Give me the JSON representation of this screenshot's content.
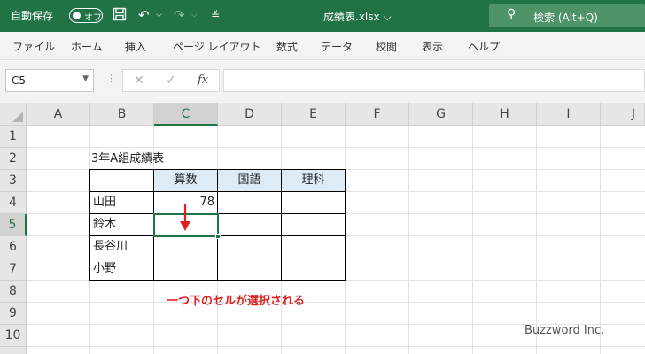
{
  "titlebar": {
    "autosave_label": "自動保存",
    "toggle_label": "オフ",
    "filename": "成績表.xlsx",
    "filename_chevron": "⌵",
    "search_placeholder": "検索 (Alt+Q)",
    "icons": [
      "save-icon",
      "undo-icon",
      "redo-icon",
      "customize-icon"
    ]
  },
  "ribbon": {
    "tabs": [
      "ファイル",
      "ホーム",
      "挿入",
      "ページ レイアウト",
      "数式",
      "データ",
      "校閲",
      "表示",
      "ヘルプ"
    ]
  },
  "formula_bar": {
    "name_box": "C5",
    "formula": "",
    "fx_label": "fx"
  },
  "grid": {
    "columns": [
      "A",
      "B",
      "C",
      "D",
      "E",
      "F",
      "G",
      "H",
      "I",
      "J"
    ],
    "rows": [
      "1",
      "2",
      "3",
      "4",
      "5",
      "6",
      "7",
      "8",
      "9",
      "10"
    ],
    "selected_column": "C",
    "selected_row": "5"
  },
  "sheet": {
    "title": "3年A組成績表",
    "headers": [
      "算数",
      "国語",
      "理科"
    ],
    "students": [
      {
        "name": "山田",
        "scores": [
          "78",
          "",
          ""
        ]
      },
      {
        "name": "鈴木",
        "scores": [
          "",
          "",
          ""
        ]
      },
      {
        "name": "長谷川",
        "scores": [
          "",
          "",
          ""
        ]
      },
      {
        "name": "小野",
        "scores": [
          "",
          "",
          ""
        ]
      }
    ]
  },
  "annotation": "一つ下のセルが選択される",
  "watermark": "Buzzword Inc.",
  "colors": {
    "excel_green": "#217346",
    "header_fill": "#ddebf7",
    "annotation_red": "#e02020"
  }
}
